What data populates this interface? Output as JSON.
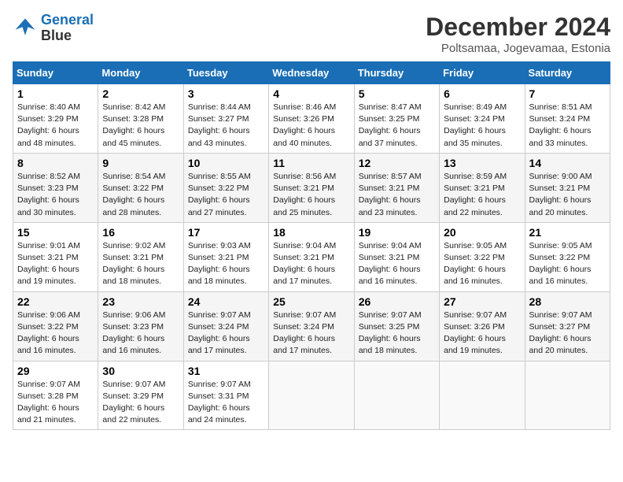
{
  "header": {
    "logo_line1": "General",
    "logo_line2": "Blue",
    "month_title": "December 2024",
    "subtitle": "Poltsamaa, Jogevamaa, Estonia"
  },
  "days_of_week": [
    "Sunday",
    "Monday",
    "Tuesday",
    "Wednesday",
    "Thursday",
    "Friday",
    "Saturday"
  ],
  "weeks": [
    [
      {
        "day": "1",
        "sunrise": "Sunrise: 8:40 AM",
        "sunset": "Sunset: 3:29 PM",
        "daylight": "Daylight: 6 hours and 48 minutes."
      },
      {
        "day": "2",
        "sunrise": "Sunrise: 8:42 AM",
        "sunset": "Sunset: 3:28 PM",
        "daylight": "Daylight: 6 hours and 45 minutes."
      },
      {
        "day": "3",
        "sunrise": "Sunrise: 8:44 AM",
        "sunset": "Sunset: 3:27 PM",
        "daylight": "Daylight: 6 hours and 43 minutes."
      },
      {
        "day": "4",
        "sunrise": "Sunrise: 8:46 AM",
        "sunset": "Sunset: 3:26 PM",
        "daylight": "Daylight: 6 hours and 40 minutes."
      },
      {
        "day": "5",
        "sunrise": "Sunrise: 8:47 AM",
        "sunset": "Sunset: 3:25 PM",
        "daylight": "Daylight: 6 hours and 37 minutes."
      },
      {
        "day": "6",
        "sunrise": "Sunrise: 8:49 AM",
        "sunset": "Sunset: 3:24 PM",
        "daylight": "Daylight: 6 hours and 35 minutes."
      },
      {
        "day": "7",
        "sunrise": "Sunrise: 8:51 AM",
        "sunset": "Sunset: 3:24 PM",
        "daylight": "Daylight: 6 hours and 33 minutes."
      }
    ],
    [
      {
        "day": "8",
        "sunrise": "Sunrise: 8:52 AM",
        "sunset": "Sunset: 3:23 PM",
        "daylight": "Daylight: 6 hours and 30 minutes."
      },
      {
        "day": "9",
        "sunrise": "Sunrise: 8:54 AM",
        "sunset": "Sunset: 3:22 PM",
        "daylight": "Daylight: 6 hours and 28 minutes."
      },
      {
        "day": "10",
        "sunrise": "Sunrise: 8:55 AM",
        "sunset": "Sunset: 3:22 PM",
        "daylight": "Daylight: 6 hours and 27 minutes."
      },
      {
        "day": "11",
        "sunrise": "Sunrise: 8:56 AM",
        "sunset": "Sunset: 3:21 PM",
        "daylight": "Daylight: 6 hours and 25 minutes."
      },
      {
        "day": "12",
        "sunrise": "Sunrise: 8:57 AM",
        "sunset": "Sunset: 3:21 PM",
        "daylight": "Daylight: 6 hours and 23 minutes."
      },
      {
        "day": "13",
        "sunrise": "Sunrise: 8:59 AM",
        "sunset": "Sunset: 3:21 PM",
        "daylight": "Daylight: 6 hours and 22 minutes."
      },
      {
        "day": "14",
        "sunrise": "Sunrise: 9:00 AM",
        "sunset": "Sunset: 3:21 PM",
        "daylight": "Daylight: 6 hours and 20 minutes."
      }
    ],
    [
      {
        "day": "15",
        "sunrise": "Sunrise: 9:01 AM",
        "sunset": "Sunset: 3:21 PM",
        "daylight": "Daylight: 6 hours and 19 minutes."
      },
      {
        "day": "16",
        "sunrise": "Sunrise: 9:02 AM",
        "sunset": "Sunset: 3:21 PM",
        "daylight": "Daylight: 6 hours and 18 minutes."
      },
      {
        "day": "17",
        "sunrise": "Sunrise: 9:03 AM",
        "sunset": "Sunset: 3:21 PM",
        "daylight": "Daylight: 6 hours and 18 minutes."
      },
      {
        "day": "18",
        "sunrise": "Sunrise: 9:04 AM",
        "sunset": "Sunset: 3:21 PM",
        "daylight": "Daylight: 6 hours and 17 minutes."
      },
      {
        "day": "19",
        "sunrise": "Sunrise: 9:04 AM",
        "sunset": "Sunset: 3:21 PM",
        "daylight": "Daylight: 6 hours and 16 minutes."
      },
      {
        "day": "20",
        "sunrise": "Sunrise: 9:05 AM",
        "sunset": "Sunset: 3:22 PM",
        "daylight": "Daylight: 6 hours and 16 minutes."
      },
      {
        "day": "21",
        "sunrise": "Sunrise: 9:05 AM",
        "sunset": "Sunset: 3:22 PM",
        "daylight": "Daylight: 6 hours and 16 minutes."
      }
    ],
    [
      {
        "day": "22",
        "sunrise": "Sunrise: 9:06 AM",
        "sunset": "Sunset: 3:22 PM",
        "daylight": "Daylight: 6 hours and 16 minutes."
      },
      {
        "day": "23",
        "sunrise": "Sunrise: 9:06 AM",
        "sunset": "Sunset: 3:23 PM",
        "daylight": "Daylight: 6 hours and 16 minutes."
      },
      {
        "day": "24",
        "sunrise": "Sunrise: 9:07 AM",
        "sunset": "Sunset: 3:24 PM",
        "daylight": "Daylight: 6 hours and 17 minutes."
      },
      {
        "day": "25",
        "sunrise": "Sunrise: 9:07 AM",
        "sunset": "Sunset: 3:24 PM",
        "daylight": "Daylight: 6 hours and 17 minutes."
      },
      {
        "day": "26",
        "sunrise": "Sunrise: 9:07 AM",
        "sunset": "Sunset: 3:25 PM",
        "daylight": "Daylight: 6 hours and 18 minutes."
      },
      {
        "day": "27",
        "sunrise": "Sunrise: 9:07 AM",
        "sunset": "Sunset: 3:26 PM",
        "daylight": "Daylight: 6 hours and 19 minutes."
      },
      {
        "day": "28",
        "sunrise": "Sunrise: 9:07 AM",
        "sunset": "Sunset: 3:27 PM",
        "daylight": "Daylight: 6 hours and 20 minutes."
      }
    ],
    [
      {
        "day": "29",
        "sunrise": "Sunrise: 9:07 AM",
        "sunset": "Sunset: 3:28 PM",
        "daylight": "Daylight: 6 hours and 21 minutes."
      },
      {
        "day": "30",
        "sunrise": "Sunrise: 9:07 AM",
        "sunset": "Sunset: 3:29 PM",
        "daylight": "Daylight: 6 hours and 22 minutes."
      },
      {
        "day": "31",
        "sunrise": "Sunrise: 9:07 AM",
        "sunset": "Sunset: 3:31 PM",
        "daylight": "Daylight: 6 hours and 24 minutes."
      },
      null,
      null,
      null,
      null
    ]
  ]
}
